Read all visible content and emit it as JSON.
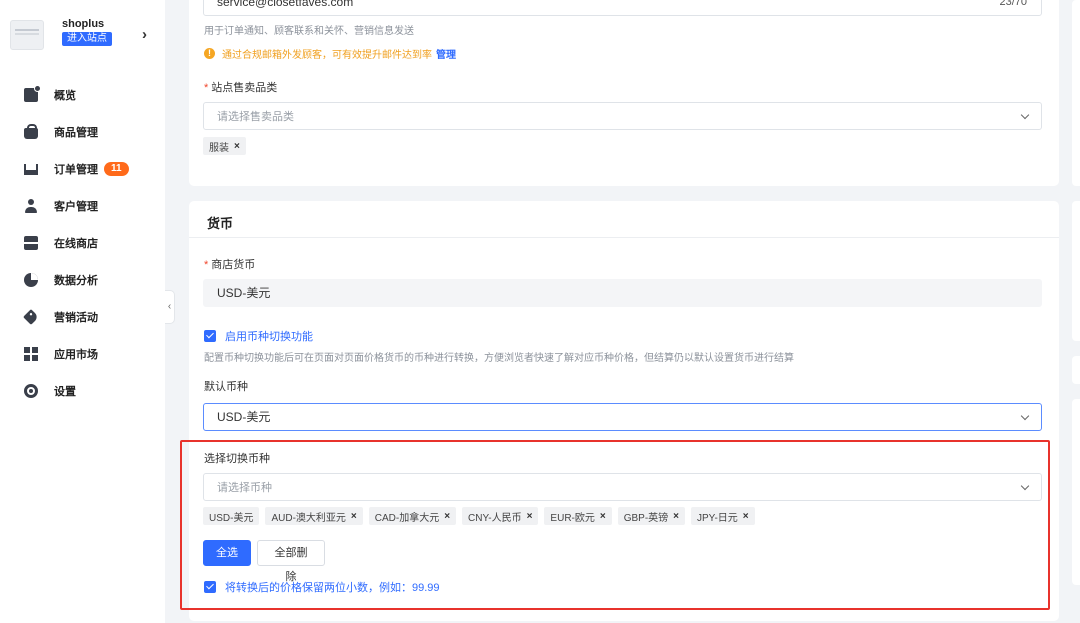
{
  "sidebar": {
    "store_name": "shoplus",
    "enter_store": "进入站点",
    "items": [
      {
        "label": "概览",
        "icon": "dashboard-icon"
      },
      {
        "label": "商品管理",
        "icon": "bag-icon"
      },
      {
        "label": "订单管理",
        "icon": "cart-icon",
        "badge": "11"
      },
      {
        "label": "客户管理",
        "icon": "user-icon"
      },
      {
        "label": "在线商店",
        "icon": "shop-icon"
      },
      {
        "label": "数据分析",
        "icon": "pie-chart-icon"
      },
      {
        "label": "营销活动",
        "icon": "tag-icon"
      },
      {
        "label": "应用市场",
        "icon": "apps-icon"
      },
      {
        "label": "设置",
        "icon": "gear-icon"
      }
    ]
  },
  "contact": {
    "email_value": "service@closetfaves.com",
    "email_counter": "23/70",
    "email_hint": "用于订单通知、顾客联系和关怀、营销信息发送",
    "warning_text": "通过合规邮箱外发顾客，可有效提升邮件达到率",
    "warning_link": "管理"
  },
  "category": {
    "label": "站点售卖品类",
    "placeholder": "请选择售卖品类",
    "tags": [
      "服装"
    ]
  },
  "currency": {
    "title": "货币",
    "store_currency_label": "商店货币",
    "store_currency_value": "USD-美元",
    "switch_enabled_label": "启用币种切换功能",
    "switch_hint": "配置币种切换功能后可在页面对页面价格货币的币种进行转换，方便浏览者快速了解对应币种价格，但结算仍以默认设置货币进行结算",
    "default_label": "默认币种",
    "default_value": "USD-美元",
    "select_label": "选择切换币种",
    "select_placeholder": "请选择币种",
    "tags": [
      {
        "text": "USD-美元",
        "removable": false
      },
      {
        "text": "AUD-澳大利亚元",
        "removable": true
      },
      {
        "text": "CAD-加拿大元",
        "removable": true
      },
      {
        "text": "CNY-人民币",
        "removable": true
      },
      {
        "text": "EUR-欧元",
        "removable": true
      },
      {
        "text": "GBP-英镑",
        "removable": true
      },
      {
        "text": "JPY-日元",
        "removable": true
      }
    ],
    "select_all": "全选",
    "clear_all": "全部删除",
    "round_label": "将转换后的价格保留两位小数，例如：99.99"
  },
  "colors": {
    "accent": "#2f6bff",
    "badge": "#ff6a1a",
    "warning": "#f5a623",
    "highlight": "#e8332c"
  }
}
